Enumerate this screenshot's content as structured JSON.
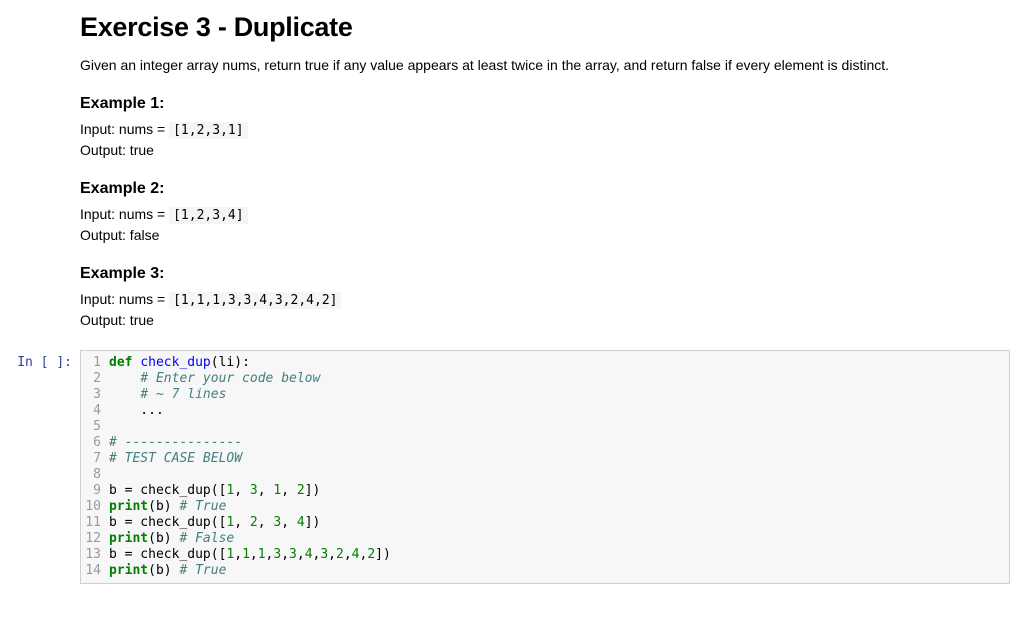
{
  "heading": "Exercise 3 - Duplicate",
  "description": "Given an integer array nums, return true if any value appears at least twice in the array, and return false if every element is distinct.",
  "examples": [
    {
      "title": "Example 1:",
      "input_label": "Input: nums = ",
      "input_code": "[1,2,3,1]",
      "output": "Output: true"
    },
    {
      "title": "Example 2:",
      "input_label": "Input: nums = ",
      "input_code": "[1,2,3,4]",
      "output": "Output: false"
    },
    {
      "title": "Example 3:",
      "input_label": "Input: nums = ",
      "input_code": "[1,1,1,3,3,4,3,2,4,2]",
      "output": "Output: true"
    }
  ],
  "prompt_label": "In [ ]:",
  "code_lines": [
    {
      "n": "1",
      "segments": [
        {
          "t": "def ",
          "c": "kw"
        },
        {
          "t": "check_dup",
          "c": "fn"
        },
        {
          "t": "(li):",
          "c": ""
        }
      ]
    },
    {
      "n": "2",
      "segments": [
        {
          "t": "    ",
          "c": ""
        },
        {
          "t": "# Enter your code below",
          "c": "cm"
        }
      ]
    },
    {
      "n": "3",
      "segments": [
        {
          "t": "    ",
          "c": ""
        },
        {
          "t": "# ~ 7 lines",
          "c": "cm"
        }
      ]
    },
    {
      "n": "4",
      "segments": [
        {
          "t": "    ...",
          "c": "ell"
        }
      ]
    },
    {
      "n": "5",
      "segments": [
        {
          "t": "",
          "c": ""
        }
      ]
    },
    {
      "n": "6",
      "segments": [
        {
          "t": "# ---------------",
          "c": "cm"
        }
      ]
    },
    {
      "n": "7",
      "segments": [
        {
          "t": "# TEST CASE BELOW",
          "c": "cm"
        }
      ]
    },
    {
      "n": "8",
      "segments": [
        {
          "t": "",
          "c": ""
        }
      ]
    },
    {
      "n": "9",
      "segments": [
        {
          "t": "b = check_dup([",
          "c": ""
        },
        {
          "t": "1",
          "c": "num"
        },
        {
          "t": ", ",
          "c": ""
        },
        {
          "t": "3",
          "c": "num"
        },
        {
          "t": ", ",
          "c": ""
        },
        {
          "t": "1",
          "c": "num"
        },
        {
          "t": ", ",
          "c": ""
        },
        {
          "t": "2",
          "c": "num"
        },
        {
          "t": "])",
          "c": ""
        }
      ]
    },
    {
      "n": "10",
      "segments": [
        {
          "t": "print",
          "c": "kw"
        },
        {
          "t": "(b) ",
          "c": ""
        },
        {
          "t": "# True",
          "c": "cm"
        }
      ]
    },
    {
      "n": "11",
      "segments": [
        {
          "t": "b = check_dup([",
          "c": ""
        },
        {
          "t": "1",
          "c": "num"
        },
        {
          "t": ", ",
          "c": ""
        },
        {
          "t": "2",
          "c": "num"
        },
        {
          "t": ", ",
          "c": ""
        },
        {
          "t": "3",
          "c": "num"
        },
        {
          "t": ", ",
          "c": ""
        },
        {
          "t": "4",
          "c": "num"
        },
        {
          "t": "])",
          "c": ""
        }
      ]
    },
    {
      "n": "12",
      "segments": [
        {
          "t": "print",
          "c": "kw"
        },
        {
          "t": "(b) ",
          "c": ""
        },
        {
          "t": "# False",
          "c": "cm"
        }
      ]
    },
    {
      "n": "13",
      "segments": [
        {
          "t": "b = check_dup([",
          "c": ""
        },
        {
          "t": "1",
          "c": "num"
        },
        {
          "t": ",",
          "c": ""
        },
        {
          "t": "1",
          "c": "num"
        },
        {
          "t": ",",
          "c": ""
        },
        {
          "t": "1",
          "c": "num"
        },
        {
          "t": ",",
          "c": ""
        },
        {
          "t": "3",
          "c": "num"
        },
        {
          "t": ",",
          "c": ""
        },
        {
          "t": "3",
          "c": "num"
        },
        {
          "t": ",",
          "c": ""
        },
        {
          "t": "4",
          "c": "num"
        },
        {
          "t": ",",
          "c": ""
        },
        {
          "t": "3",
          "c": "num"
        },
        {
          "t": ",",
          "c": ""
        },
        {
          "t": "2",
          "c": "num"
        },
        {
          "t": ",",
          "c": ""
        },
        {
          "t": "4",
          "c": "num"
        },
        {
          "t": ",",
          "c": ""
        },
        {
          "t": "2",
          "c": "num"
        },
        {
          "t": "])",
          "c": ""
        }
      ]
    },
    {
      "n": "14",
      "segments": [
        {
          "t": "print",
          "c": "kw"
        },
        {
          "t": "(b) ",
          "c": ""
        },
        {
          "t": "# True",
          "c": "cm"
        }
      ]
    }
  ]
}
